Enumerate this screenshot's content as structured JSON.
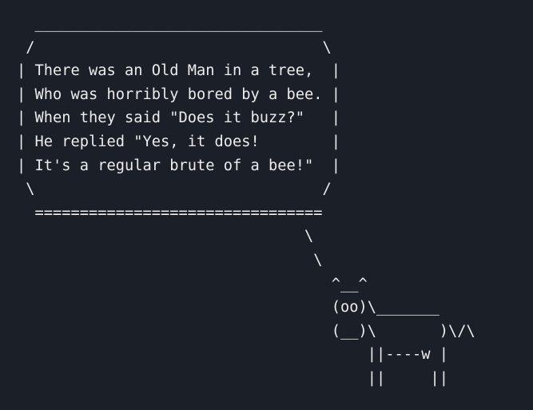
{
  "terminal": {
    "lines": [
      "  ________________________________",
      " /                                \\",
      "| There was an Old Man in a tree,  |",
      "| Who was horribly bored by a bee. |",
      "| When they said \"Does it buzz?\"   |",
      "| He replied \"Yes, it does!        |",
      "| It's a regular brute of a bee!\"  |",
      " \\                                /",
      "  ================================",
      "                                \\",
      "                                 \\",
      "                                   ^__^",
      "                                   (oo)\\_______",
      "                                   (__)\\       )\\/\\",
      "                                       ||----w |",
      "                                       ||     ||"
    ]
  }
}
